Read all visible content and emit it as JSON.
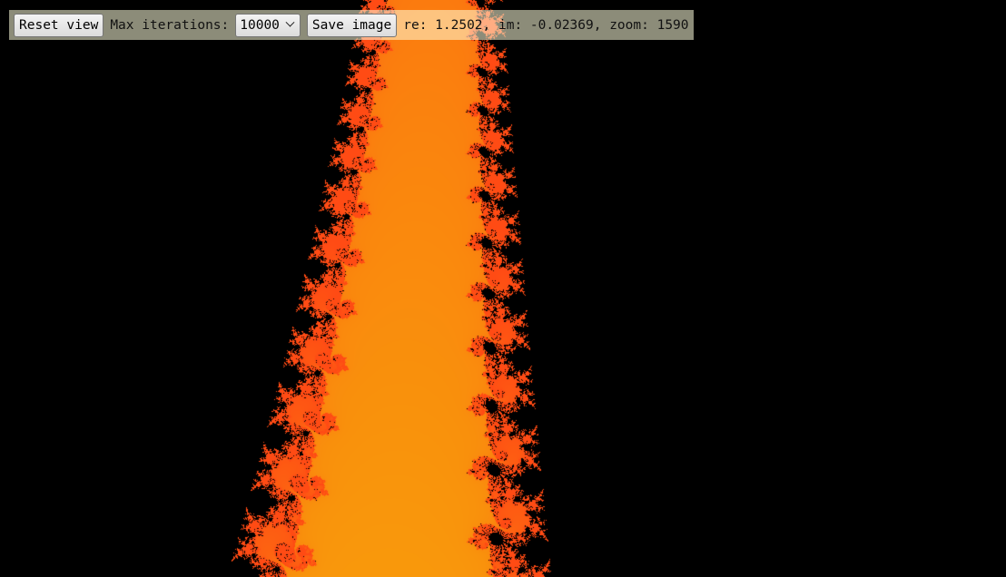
{
  "toolbar": {
    "reset_label": "Reset view",
    "max_iter_label": "Max iterations:",
    "max_iter_value": "10000",
    "save_label": "Save image",
    "coords_text": "re: 1.2502, im: -0.02369, zoom: 1590"
  },
  "colors": {
    "background": "#f0ff00",
    "inner": "#ff6a1a",
    "set": "#000000"
  }
}
